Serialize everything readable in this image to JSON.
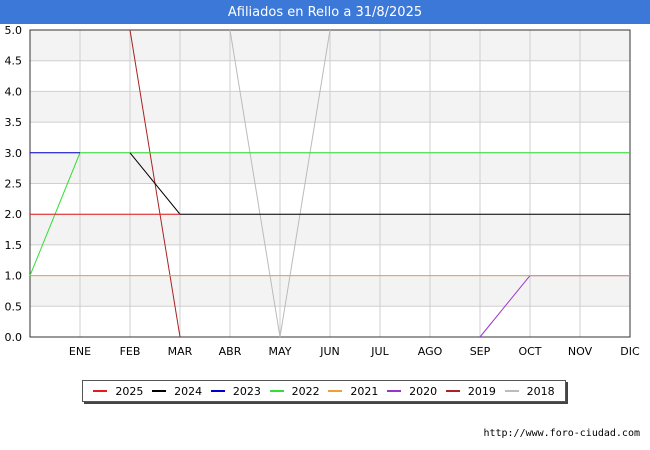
{
  "header": {
    "title": "Afiliados en Rello a 31/8/2025"
  },
  "footer": {
    "url": "http://www.foro-ciudad.com"
  },
  "colors": {
    "title_bar": "#3c78d8",
    "band": "#f3f3f3",
    "grid": "#cfcfcf"
  },
  "chart_data": {
    "type": "line",
    "title": "Afiliados en Rello a 31/8/2025",
    "xlabel": "",
    "ylabel": "",
    "categories": [
      "ENE",
      "FEB",
      "MAR",
      "ABR",
      "MAY",
      "JUN",
      "JUL",
      "AGO",
      "SEP",
      "OCT",
      "NOV",
      "DIC"
    ],
    "y_ticks": [
      "0.0",
      "0.5",
      "1.0",
      "1.5",
      "2.0",
      "2.5",
      "3.0",
      "3.5",
      "4.0",
      "4.5",
      "5.0"
    ],
    "ylim": [
      0,
      5
    ],
    "grid": true,
    "legend_position": "bottom",
    "series": [
      {
        "name": "2025",
        "color": "#e41a1c",
        "points": [
          [
            "start",
            2
          ],
          [
            "ENE",
            2
          ],
          [
            "FEB",
            2
          ],
          [
            "MAR",
            2
          ]
        ]
      },
      {
        "name": "2024",
        "color": "#000000",
        "points": [
          [
            "FEB",
            3
          ],
          [
            "MAR",
            2
          ],
          [
            "ABR",
            2
          ],
          [
            "MAY",
            2
          ],
          [
            "JUN",
            2
          ],
          [
            "JUL",
            2
          ],
          [
            "AGO",
            2
          ],
          [
            "SEP",
            2
          ],
          [
            "OCT",
            2
          ],
          [
            "NOV",
            2
          ],
          [
            "DIC",
            2
          ]
        ]
      },
      {
        "name": "2023",
        "color": "#0000cc",
        "points": [
          [
            "start",
            3
          ],
          [
            "ENE",
            3
          ]
        ]
      },
      {
        "name": "2022",
        "color": "#33dd33",
        "points": [
          [
            "start",
            1
          ],
          [
            "ENE",
            3
          ],
          [
            "FEB",
            3
          ],
          [
            "MAR",
            3
          ],
          [
            "ABR",
            3
          ],
          [
            "MAY",
            3
          ],
          [
            "JUN",
            3
          ],
          [
            "JUL",
            3
          ],
          [
            "AGO",
            3
          ],
          [
            "SEP",
            3
          ],
          [
            "OCT",
            3
          ],
          [
            "NOV",
            3
          ],
          [
            "DIC",
            3
          ]
        ]
      },
      {
        "name": "2021",
        "color": "#f0a030",
        "points": [
          [
            "start",
            1
          ],
          [
            "ENE",
            1
          ],
          [
            "FEB",
            1
          ],
          [
            "MAR",
            1
          ],
          [
            "ABR",
            1
          ],
          [
            "MAY",
            1
          ],
          [
            "JUN",
            1
          ],
          [
            "JUL",
            1
          ],
          [
            "AGO",
            1
          ],
          [
            "SEP",
            1
          ],
          [
            "OCT",
            1
          ],
          [
            "NOV",
            1
          ],
          [
            "DIC",
            1
          ]
        ]
      },
      {
        "name": "2020",
        "color": "#9933cc",
        "points": [
          [
            "SEP",
            0
          ],
          [
            "OCT",
            1
          ],
          [
            "NOV",
            1
          ],
          [
            "DIC",
            1
          ]
        ]
      },
      {
        "name": "2019",
        "color": "#aa2222",
        "points": [
          [
            "FEB",
            5
          ],
          [
            "MAR",
            0
          ]
        ]
      },
      {
        "name": "2018",
        "color": "#bbbbbb",
        "points": [
          [
            "ABR",
            5
          ],
          [
            "MAY",
            0
          ],
          [
            "JUN",
            5
          ]
        ]
      }
    ]
  }
}
